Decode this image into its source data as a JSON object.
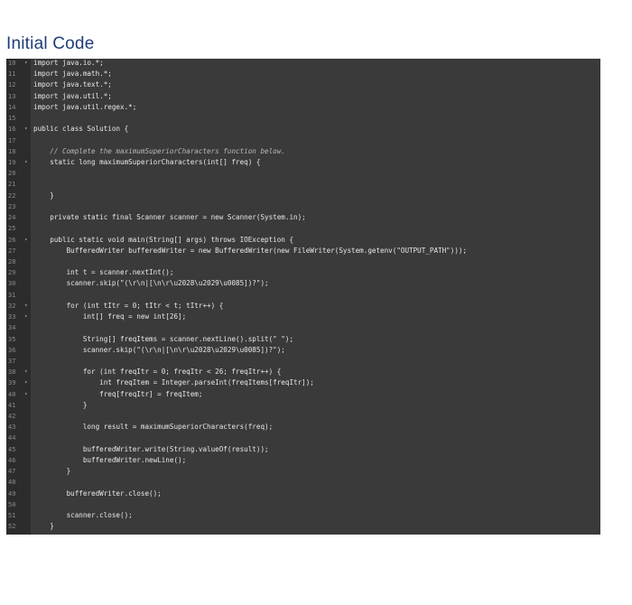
{
  "heading": "Initial Code",
  "lines": [
    {
      "n": "10",
      "fold": true,
      "text": "import java.io.*;"
    },
    {
      "n": "11",
      "fold": false,
      "text": "import java.math.*;"
    },
    {
      "n": "12",
      "fold": false,
      "text": "import java.text.*;"
    },
    {
      "n": "13",
      "fold": false,
      "text": "import java.util.*;"
    },
    {
      "n": "14",
      "fold": false,
      "text": "import java.util.regex.*;"
    },
    {
      "n": "15",
      "fold": false,
      "text": ""
    },
    {
      "n": "16",
      "fold": true,
      "text": "public class Solution {"
    },
    {
      "n": "17",
      "fold": false,
      "text": ""
    },
    {
      "n": "18",
      "fold": false,
      "text": "    // Complete the maximumSuperiorCharacters function below."
    },
    {
      "n": "19",
      "fold": true,
      "text": "    static long maximumSuperiorCharacters(int[] freq) {"
    },
    {
      "n": "20",
      "fold": false,
      "text": ""
    },
    {
      "n": "21",
      "fold": false,
      "text": ""
    },
    {
      "n": "22",
      "fold": false,
      "text": "    }"
    },
    {
      "n": "23",
      "fold": false,
      "text": ""
    },
    {
      "n": "24",
      "fold": false,
      "text": "    private static final Scanner scanner = new Scanner(System.in);"
    },
    {
      "n": "25",
      "fold": false,
      "text": ""
    },
    {
      "n": "26",
      "fold": true,
      "text": "    public static void main(String[] args) throws IOException {"
    },
    {
      "n": "27",
      "fold": false,
      "text": "        BufferedWriter bufferedWriter = new BufferedWriter(new FileWriter(System.getenv(\"OUTPUT_PATH\")));"
    },
    {
      "n": "28",
      "fold": false,
      "text": ""
    },
    {
      "n": "29",
      "fold": false,
      "text": "        int t = scanner.nextInt();"
    },
    {
      "n": "30",
      "fold": false,
      "text": "        scanner.skip(\"(\\r\\n|[\\n\\r\\u2028\\u2029\\u0085])?\");"
    },
    {
      "n": "31",
      "fold": false,
      "text": ""
    },
    {
      "n": "32",
      "fold": true,
      "text": "        for (int tItr = 0; tItr < t; tItr++) {"
    },
    {
      "n": "33",
      "fold": true,
      "text": "            int[] freq = new int[26];"
    },
    {
      "n": "34",
      "fold": false,
      "text": ""
    },
    {
      "n": "35",
      "fold": false,
      "text": "            String[] freqItems = scanner.nextLine().split(\" \");"
    },
    {
      "n": "36",
      "fold": false,
      "text": "            scanner.skip(\"(\\r\\n|[\\n\\r\\u2028\\u2029\\u0085])?\");"
    },
    {
      "n": "37",
      "fold": false,
      "text": ""
    },
    {
      "n": "38",
      "fold": true,
      "text": "            for (int freqItr = 0; freqItr < 26; freqItr++) {"
    },
    {
      "n": "39",
      "fold": true,
      "text": "                int freqItem = Integer.parseInt(freqItems[freqItr]);"
    },
    {
      "n": "40",
      "fold": true,
      "text": "                freq[freqItr] = freqItem;"
    },
    {
      "n": "41",
      "fold": false,
      "text": "            }"
    },
    {
      "n": "42",
      "fold": false,
      "text": ""
    },
    {
      "n": "43",
      "fold": false,
      "text": "            long result = maximumSuperiorCharacters(freq);"
    },
    {
      "n": "44",
      "fold": false,
      "text": ""
    },
    {
      "n": "45",
      "fold": false,
      "text": "            bufferedWriter.write(String.valueOf(result));"
    },
    {
      "n": "46",
      "fold": false,
      "text": "            bufferedWriter.newLine();"
    },
    {
      "n": "47",
      "fold": false,
      "text": "        }"
    },
    {
      "n": "48",
      "fold": false,
      "text": ""
    },
    {
      "n": "49",
      "fold": false,
      "text": "        bufferedWriter.close();"
    },
    {
      "n": "50",
      "fold": false,
      "text": ""
    },
    {
      "n": "51",
      "fold": false,
      "text": "        scanner.close();"
    },
    {
      "n": "52",
      "fold": false,
      "text": "    }"
    }
  ]
}
